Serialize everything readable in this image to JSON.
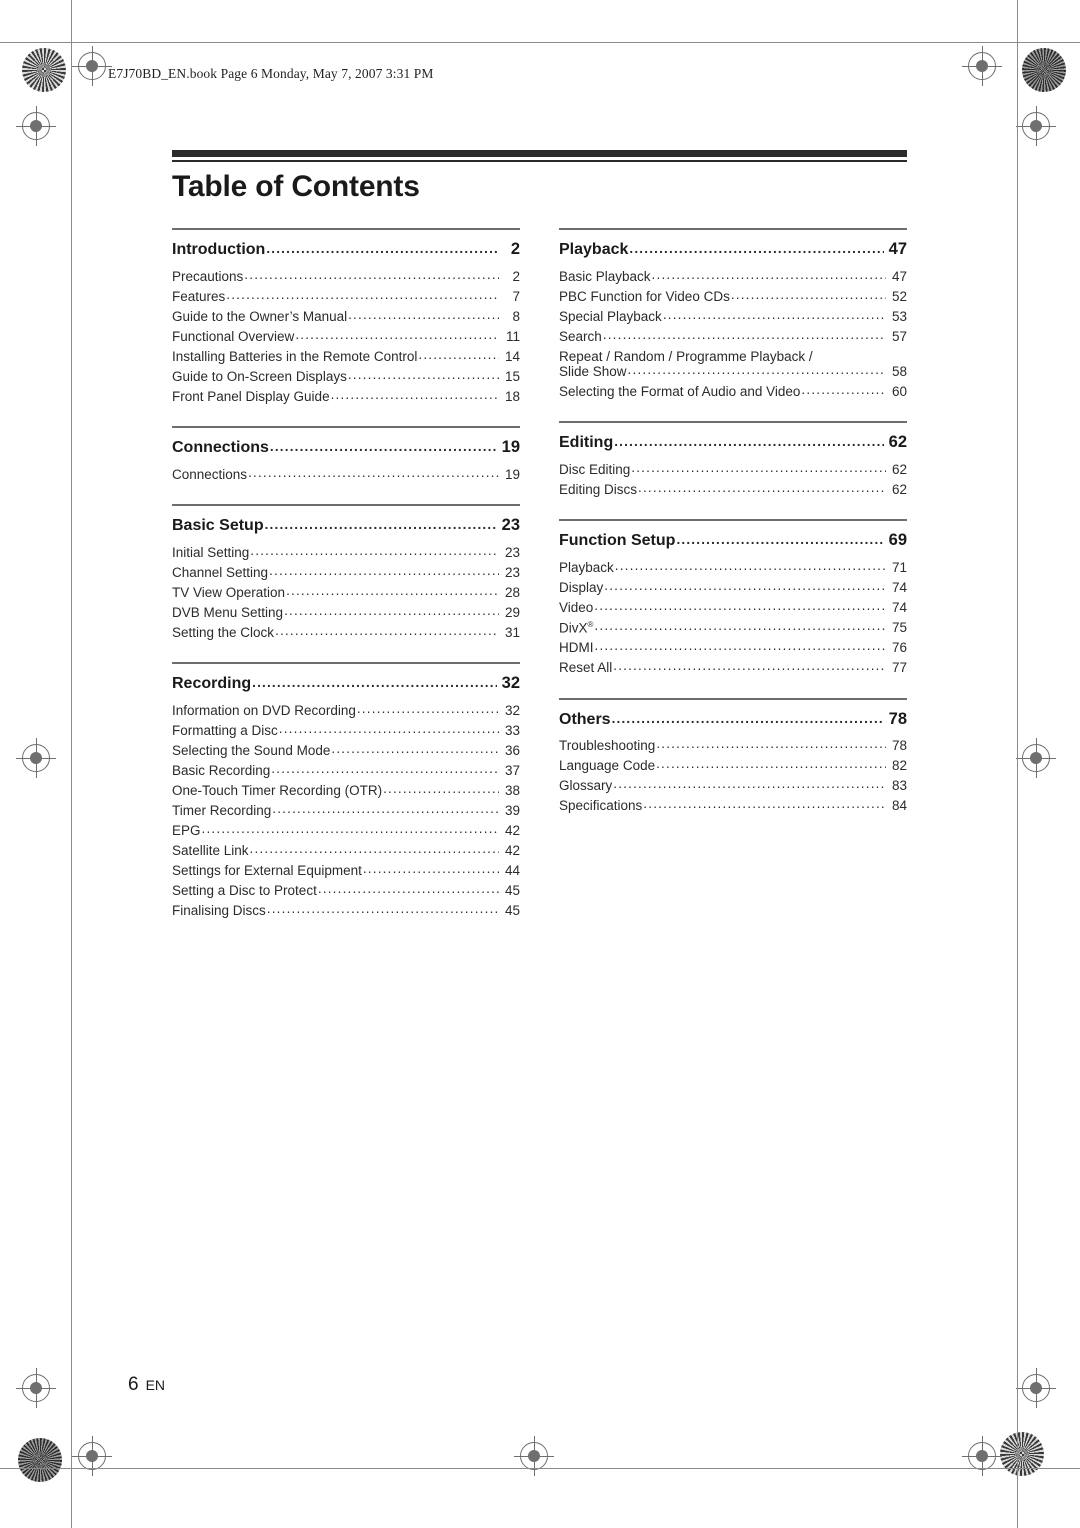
{
  "header": {
    "file_line": "E7J70BD_EN.book  Page 6  Monday, May 7, 2007  3:31 PM"
  },
  "page_title": "Table of Contents",
  "footer": {
    "page_number": "6",
    "language": "EN"
  },
  "columns": {
    "left": [
      {
        "heading": {
          "label": "Introduction",
          "page": "2"
        },
        "entries": [
          {
            "label": "Precautions",
            "page": "2"
          },
          {
            "label": "Features",
            "page": "7"
          },
          {
            "label": "Guide to the Owner’s Manual",
            "page": "8"
          },
          {
            "label": "Functional Overview",
            "page": "11"
          },
          {
            "label": "Installing Batteries in the Remote Control",
            "page": "14"
          },
          {
            "label": "Guide to On-Screen Displays",
            "page": "15"
          },
          {
            "label": "Front Panel Display Guide",
            "page": "18"
          }
        ]
      },
      {
        "heading": {
          "label": "Connections",
          "page": "19"
        },
        "entries": [
          {
            "label": "Connections",
            "page": "19"
          }
        ]
      },
      {
        "heading": {
          "label": "Basic Setup",
          "page": "23"
        },
        "entries": [
          {
            "label": "Initial Setting",
            "page": "23"
          },
          {
            "label": "Channel Setting",
            "page": "23"
          },
          {
            "label": "TV View Operation",
            "page": "28"
          },
          {
            "label": "DVB Menu Setting",
            "page": "29"
          },
          {
            "label": "Setting the Clock",
            "page": "31"
          }
        ]
      },
      {
        "heading": {
          "label": "Recording",
          "page": "32"
        },
        "entries": [
          {
            "label": "Information on DVD Recording",
            "page": "32"
          },
          {
            "label": "Formatting a Disc",
            "page": "33"
          },
          {
            "label": "Selecting the Sound Mode",
            "page": "36"
          },
          {
            "label": "Basic Recording",
            "page": "37"
          },
          {
            "label": "One-Touch Timer Recording (OTR)",
            "page": "38"
          },
          {
            "label": "Timer Recording",
            "page": "39"
          },
          {
            "label": "EPG",
            "page": "42"
          },
          {
            "label": "Satellite Link",
            "page": "42"
          },
          {
            "label": "Settings for External Equipment",
            "page": "44"
          },
          {
            "label": "Setting a Disc to Protect",
            "page": "45"
          },
          {
            "label": "Finalising Discs",
            "page": "45"
          }
        ]
      }
    ],
    "right": [
      {
        "heading": {
          "label": "Playback",
          "page": "47"
        },
        "entries": [
          {
            "label": "Basic Playback",
            "page": "47"
          },
          {
            "label": "PBC Function for Video CDs",
            "page": "52"
          },
          {
            "label": "Special Playback",
            "page": "53"
          },
          {
            "label": "Search",
            "page": "57"
          },
          {
            "label": "Repeat / Random / Programme Playback /",
            "label2": "Slide Show",
            "page": "58",
            "wrapped": true
          },
          {
            "label": "Selecting the Format of Audio and Video",
            "page": "60"
          }
        ]
      },
      {
        "heading": {
          "label": "Editing",
          "page": "62"
        },
        "entries": [
          {
            "label": "Disc Editing",
            "page": "62"
          },
          {
            "label": "Editing Discs",
            "page": "62"
          }
        ]
      },
      {
        "heading": {
          "label": "Function Setup",
          "page": "69"
        },
        "entries": [
          {
            "label": "Playback",
            "page": "71"
          },
          {
            "label": "Display",
            "page": "74"
          },
          {
            "label": "Video",
            "page": "74"
          },
          {
            "label": "DivX",
            "page": "75",
            "sup": "®"
          },
          {
            "label": "HDMI",
            "page": "76"
          },
          {
            "label": "Reset All",
            "page": "77"
          }
        ]
      },
      {
        "heading": {
          "label": "Others",
          "page": "78"
        },
        "entries": [
          {
            "label": "Troubleshooting",
            "page": "78"
          },
          {
            "label": "Language Code",
            "page": "82"
          },
          {
            "label": "Glossary",
            "page": "83"
          },
          {
            "label": "Specifications",
            "page": "84"
          }
        ]
      }
    ]
  }
}
